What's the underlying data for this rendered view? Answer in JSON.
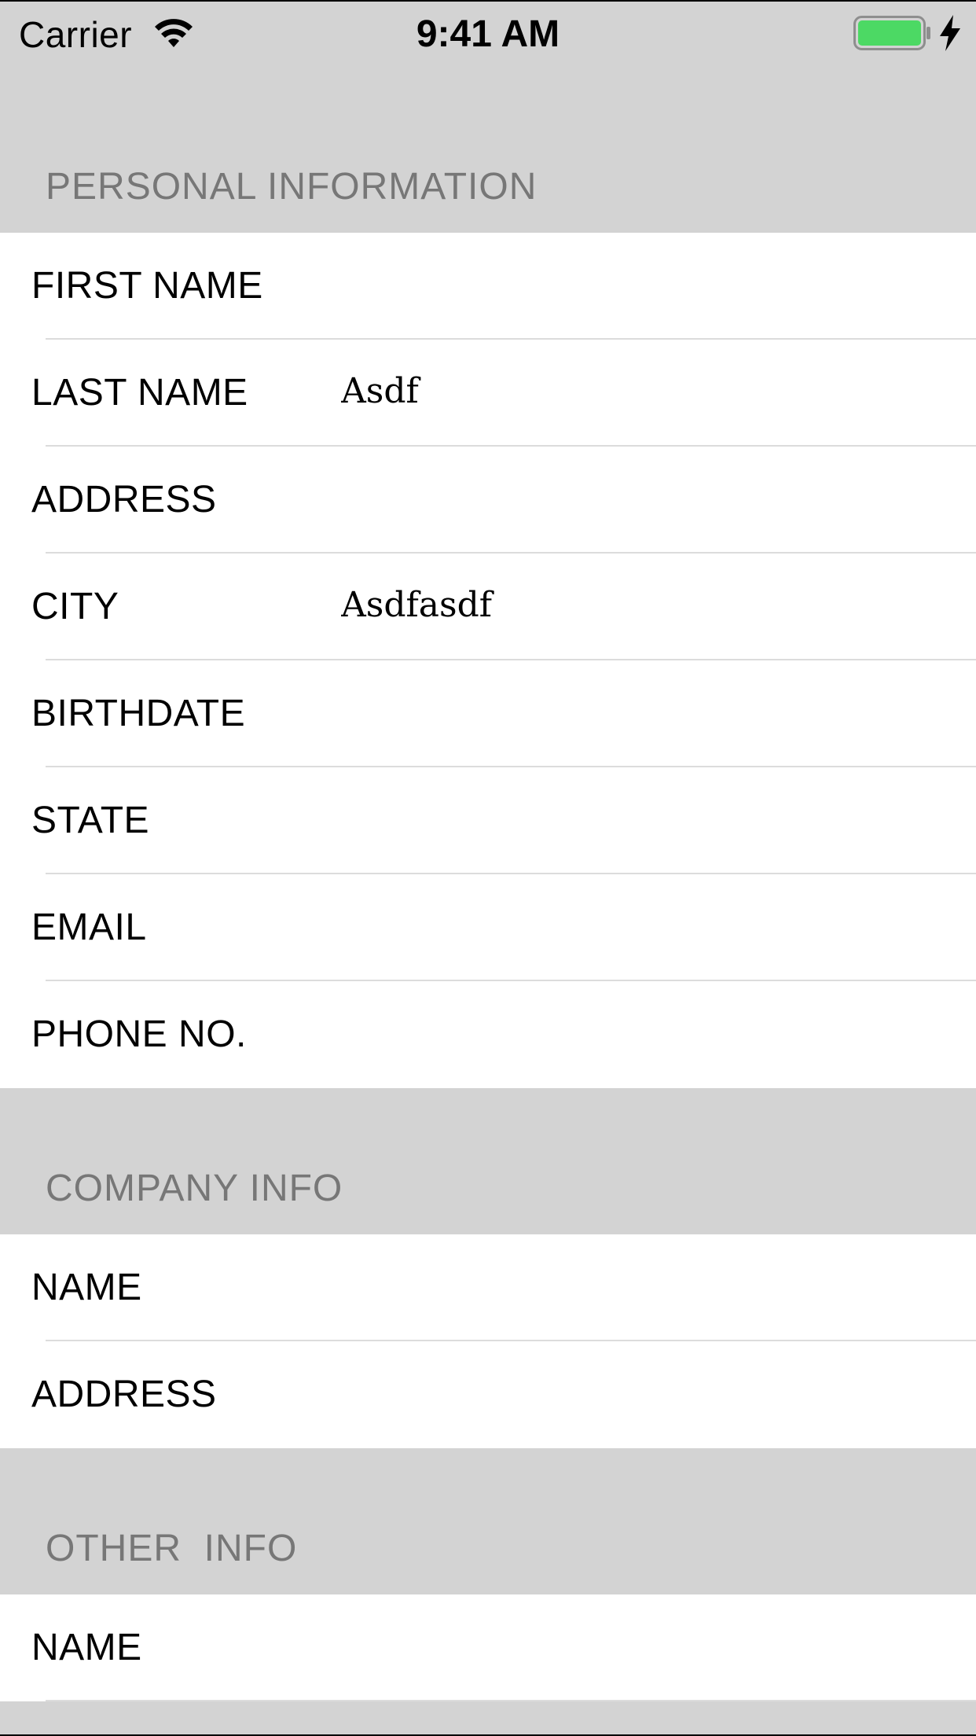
{
  "status_bar": {
    "carrier": "Carrier",
    "time": "9:41 AM",
    "wifi_icon": "wifi-icon",
    "battery_icon": "battery-icon",
    "battery_level": 1.0,
    "battery_color": "#4cd964",
    "charging_icon": "charging-bolt-icon"
  },
  "colors": {
    "background": "#d3d3d3",
    "header_text": "#777777",
    "row_background": "#ffffff",
    "separator": "#dcdcdc"
  },
  "personal": {
    "header": "PERSONAL INFORMATION",
    "rows": [
      {
        "label": "FIRST NAME",
        "value": ""
      },
      {
        "label": "LAST NAME",
        "value": "Asdf"
      },
      {
        "label": "ADDRESS",
        "value": ""
      },
      {
        "label": "CITY",
        "value": "Asdfasdf"
      },
      {
        "label": "BIRTHDATE",
        "value": ""
      },
      {
        "label": "STATE",
        "value": ""
      },
      {
        "label": "EMAIL",
        "value": ""
      },
      {
        "label": "PHONE NO.",
        "value": ""
      }
    ]
  },
  "company": {
    "header": "COMPANY INFO",
    "rows": [
      {
        "label": "NAME",
        "value": ""
      },
      {
        "label": "ADDRESS",
        "value": ""
      }
    ]
  },
  "other": {
    "header": "OTHER  INFO",
    "rows": [
      {
        "label": "NAME",
        "value": ""
      }
    ]
  }
}
